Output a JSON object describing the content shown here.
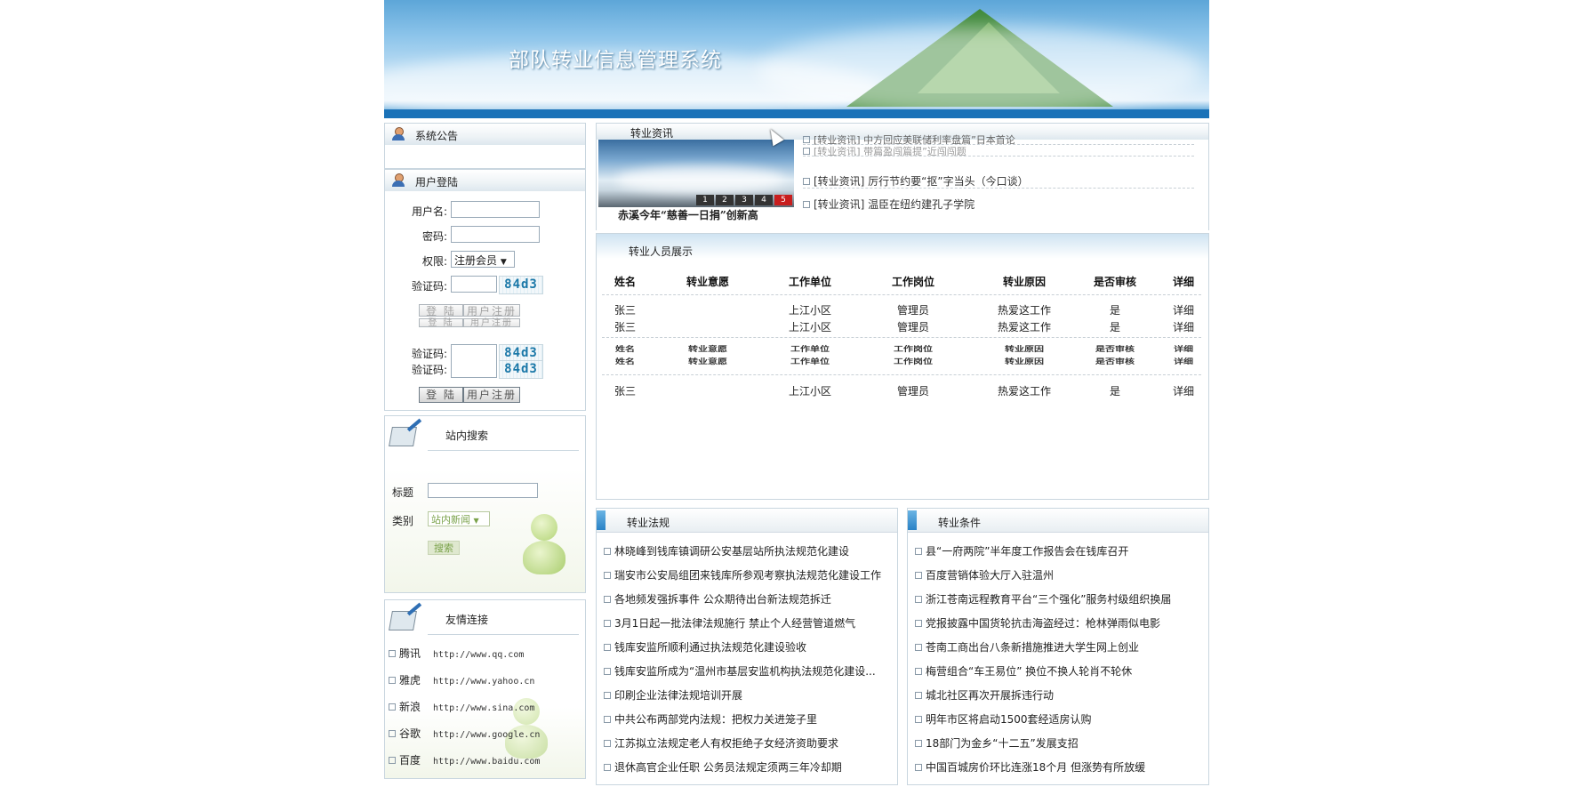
{
  "header": {
    "title": "部队转业信息管理系统"
  },
  "announcement": {
    "title": "系统公告"
  },
  "login": {
    "title": "用户登陆",
    "username_label": "用户名:",
    "password_label": "密码:",
    "role_label": "权限:",
    "role_value": "注册会员",
    "captcha_label": "验证码:",
    "captcha_code": "84d3",
    "login_button": "登 陆",
    "register_button": "用户注册"
  },
  "search": {
    "title": "站内搜索",
    "title_label": "标题",
    "category_label": "类别",
    "category_value": "站内新闻",
    "search_button": "搜索"
  },
  "links": {
    "title": "友情连接",
    "items": [
      {
        "name": "腾讯",
        "url": "http://www.qq.com"
      },
      {
        "name": "雅虎",
        "url": "http://www.yahoo.cn"
      },
      {
        "name": "新浪",
        "url": "http://www.sina.com"
      },
      {
        "name": "谷歌",
        "url": "http://www.google.cn"
      },
      {
        "name": "百度",
        "url": "http://www.baidu.com"
      }
    ]
  },
  "news": {
    "title": "转业资讯",
    "caption": "赤溪今年“慈善一日捐”创新高",
    "pages": [
      "1",
      "2",
      "3",
      "4",
      "5"
    ],
    "items": [
      "[转业资讯] 中方回应美联储利率盘篇”日本首论",
      "[转业资讯] 带篇盈闯篇提”近闯闯题",
      "[转业资讯] 厉行节约要“抠”字当头（今口谈）",
      "[转业资讯] 温臣在纽约建孔子学院"
    ]
  },
  "personnel": {
    "title": "转业人员展示",
    "headers": [
      "姓名",
      "转业意愿",
      "工作单位",
      "工作岗位",
      "转业原因",
      "是否审核",
      "详细"
    ],
    "rows": [
      [
        "张三",
        "",
        "上江小区",
        "管理员",
        "热爱这工作",
        "是",
        "详细"
      ],
      [
        "张三",
        "",
        "上江小区",
        "管理员",
        "热爱这工作",
        "是",
        "详细"
      ],
      [
        "张三",
        "",
        "上江小区",
        "管理员",
        "热爱这工作",
        "是",
        "详细"
      ]
    ]
  },
  "laws": {
    "title": "转业法规",
    "items": [
      "林晓峰到钱库镇调研公安基层站所执法规范化建设",
      "瑞安市公安局组团来钱库所参观考察执法规范化建设工作",
      "各地频发强拆事件 公众期待出台新法规范拆迁",
      "3月1日起一批法律法规施行 禁止个人经营管道燃气",
      "钱库安监所顺利通过执法规范化建设验收",
      "钱库安监所成为“温州市基层安监机构执法规范化建设...",
      "印刷企业法律法规培训开展",
      "中共公布两部党内法规：把权力关进笼子里",
      "江苏拟立法规定老人有权拒绝子女经济资助要求",
      "退休高官企业任职 公务员法规定须两三年冷却期"
    ]
  },
  "conditions": {
    "title": "转业条件",
    "items": [
      "县“一府两院”半年度工作报告会在钱库召开",
      "百度营销体验大厅入驻温州",
      "浙江苍南远程教育平台“三个强化”服务村级组织换届",
      "党报披露中国货轮抗击海盗经过：枪林弹雨似电影",
      "苍南工商出台八条新措施推进大学生网上创业",
      "梅营组合“车王易位” 换位不换人轮肖不轮休",
      "城北社区再次开展拆违行动",
      "明年市区将启动1500套经适房认购",
      "18部门为金乡“十二五”发展支招",
      "中国百城房价环比连涨18个月 但涨势有所放缓"
    ]
  }
}
